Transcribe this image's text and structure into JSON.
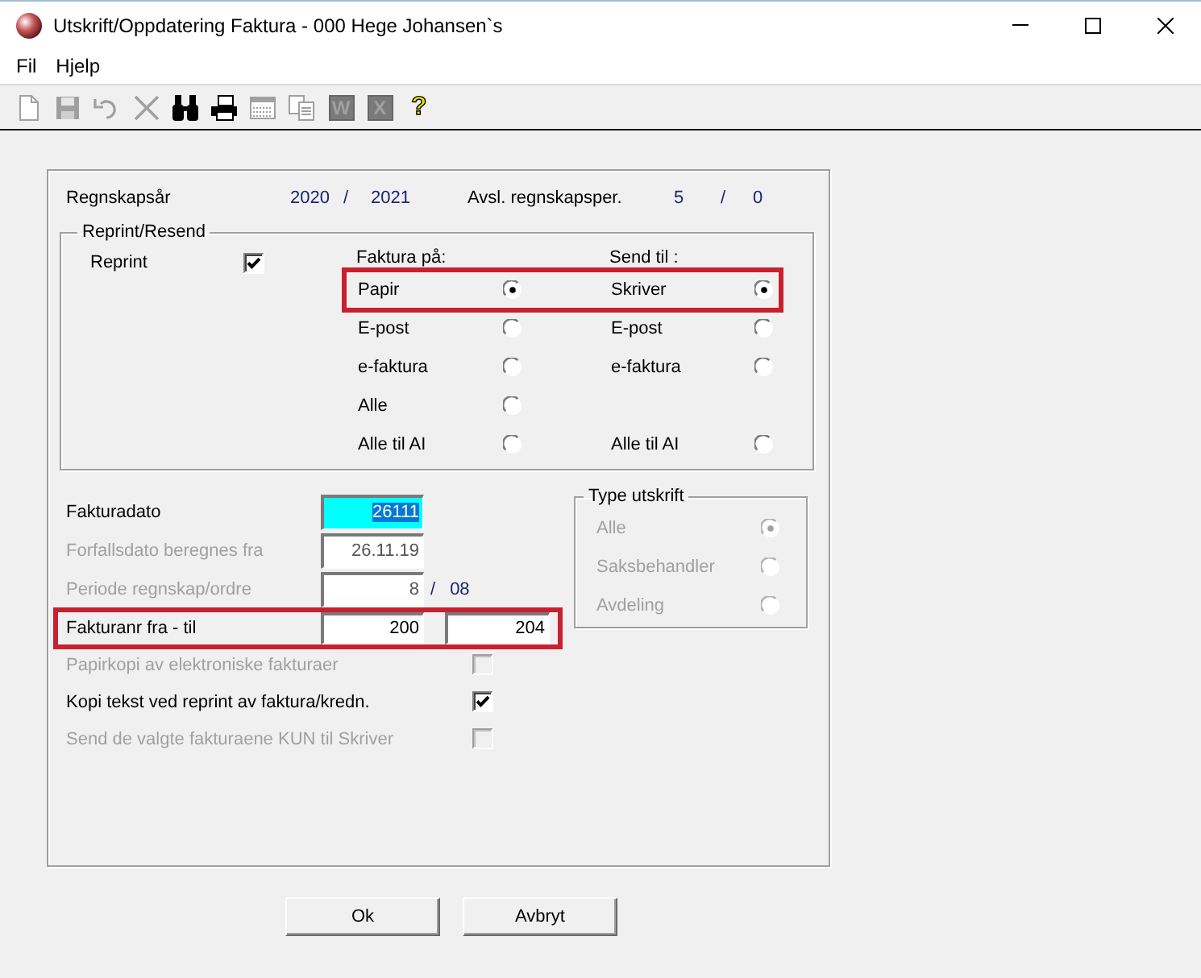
{
  "window": {
    "title": "Utskrift/Oppdatering Faktura - 000 Hege Johansen`s"
  },
  "menu": [
    "Fil",
    "Hjelp"
  ],
  "toolbar": [
    {
      "kind": "new",
      "disabled": true
    },
    {
      "kind": "save",
      "disabled": true
    },
    {
      "kind": "undo",
      "disabled": true
    },
    {
      "kind": "delete",
      "disabled": true
    },
    {
      "kind": "find",
      "disabled": false
    },
    {
      "kind": "print",
      "disabled": false
    },
    {
      "kind": "form",
      "disabled": true
    },
    {
      "kind": "copy",
      "disabled": true
    },
    {
      "kind": "letter",
      "glyph": "W",
      "disabled": true
    },
    {
      "kind": "letter",
      "glyph": "X",
      "disabled": true
    },
    {
      "kind": "help",
      "glyph": "?",
      "disabled": false
    }
  ],
  "fiscal_year": {
    "label": "Regnskapsår",
    "from": "2020",
    "separator": "/",
    "to": "2021"
  },
  "closed_period": {
    "label": "Avsl. regnskapsper.",
    "from": "5",
    "separator": "/",
    "to": "0"
  },
  "reprint_group": {
    "title": "Reprint/Resend",
    "reprint": {
      "label": "Reprint",
      "checked": true
    },
    "headings": [
      "Faktura på:",
      "Send til :"
    ],
    "rows": [
      {
        "highlighted": true,
        "invoice": {
          "label": "Papir",
          "selected": true
        },
        "send": {
          "label": "Skriver",
          "selected": true
        }
      },
      {
        "highlighted": false,
        "invoice": {
          "label": "E-post",
          "selected": false
        },
        "send": {
          "label": "E-post",
          "selected": false
        }
      },
      {
        "highlighted": false,
        "invoice": {
          "label": "e-faktura",
          "selected": false
        },
        "send": {
          "label": "e-faktura",
          "selected": false
        }
      },
      {
        "highlighted": false,
        "invoice": {
          "label": "Alle",
          "selected": false
        }
      },
      {
        "highlighted": false,
        "invoice": {
          "label": "Alle til AI",
          "selected": false
        },
        "send": {
          "label": "Alle til AI",
          "selected": false
        }
      }
    ]
  },
  "fields": [
    {
      "label": "Fakturadato",
      "values": [
        "26111"
      ],
      "disabled": false,
      "focused": true,
      "highlighted": false
    },
    {
      "label": "Forfallsdato beregnes fra",
      "values": [
        "26.11.19"
      ],
      "disabled": true,
      "focused": false,
      "highlighted": false
    },
    {
      "label": "Periode regnskap/ordre",
      "values": [
        "8"
      ],
      "separator": "/",
      "suffix": "08",
      "disabled": true,
      "focused": false,
      "highlighted": false
    },
    {
      "label": "Fakturanr fra - til",
      "values": [
        "200",
        "204"
      ],
      "disabled": false,
      "focused": false,
      "highlighted": true
    }
  ],
  "checkboxes": [
    {
      "label": "Papirkopi av elektroniske fakturaer",
      "checked": false,
      "disabled": true
    },
    {
      "label": "Kopi tekst ved reprint av faktura/kredn.",
      "checked": true,
      "disabled": false
    },
    {
      "label": "Send de valgte fakturaene KUN til Skriver",
      "checked": false,
      "disabled": true
    }
  ],
  "print_type": {
    "title": "Type utskrift",
    "disabled": true,
    "options": [
      {
        "label": "Alle",
        "selected": true
      },
      {
        "label": "Saksbehandler",
        "selected": false
      },
      {
        "label": "Avdeling",
        "selected": false
      }
    ]
  },
  "buttons": [
    "Ok",
    "Avbryt"
  ]
}
